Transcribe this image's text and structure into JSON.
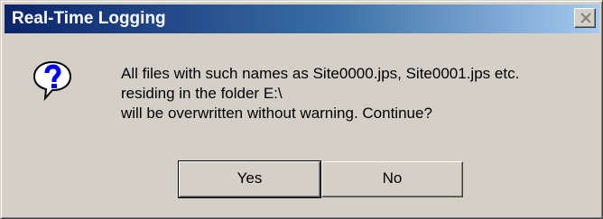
{
  "dialog": {
    "title": "Real-Time Logging",
    "icon": "question-icon",
    "message_lines": [
      "All files with such names as Site0000.jps, Site0001.jps etc.",
      "residing in the folder E:\\",
      "will be overwritten without warning. Continue?"
    ],
    "buttons": {
      "yes": "Yes",
      "no": "No"
    }
  },
  "colors": {
    "titlebar_start": "#0a246a",
    "titlebar_end": "#a6caf0",
    "face": "#d4d0c8",
    "icon_blue": "#0000ff"
  }
}
